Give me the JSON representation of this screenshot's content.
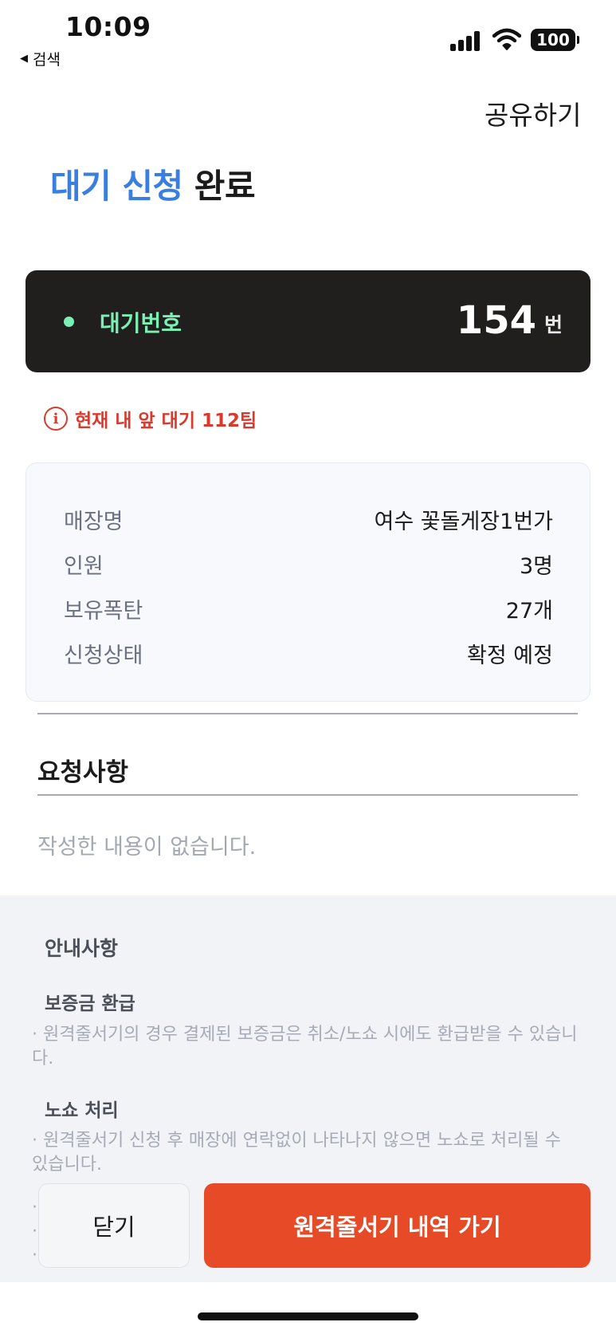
{
  "status_bar": {
    "time": "10:09",
    "back_label": "검색",
    "battery": "100"
  },
  "header": {
    "share_label": "공유하기"
  },
  "title": {
    "highlight": "대기 신청",
    "rest": " 완료",
    "highlight_color": "#3a7ee2"
  },
  "wait_card": {
    "label": "대기번호",
    "number": "154",
    "unit": "번",
    "accent_color": "#7af0b4"
  },
  "ahead_notice": {
    "icon": "info-icon",
    "text": "현재 내 앞 대기 112팀"
  },
  "details": [
    {
      "key": "매장명",
      "value": "여수 꽃돌게장1번가"
    },
    {
      "key": "인원",
      "value": "3명"
    },
    {
      "key": "보유폭탄",
      "value": "27개"
    },
    {
      "key": "신청상태",
      "value": "확정 예정"
    }
  ],
  "request": {
    "title": "요청사항",
    "empty_text": "작성한 내용이 없습니다."
  },
  "notice": {
    "title": "안내사항",
    "sections": [
      {
        "heading": "보증금 환급",
        "body": "· 원격줄서기의 경우 결제된 보증금은 취소/노쇼 시에도 환급받을 수 있습니다."
      },
      {
        "heading": "노쇼 처리",
        "body": "· 원격줄서기 신청 후 매장에 연락없이 나타나지 않으면 노쇼로 처리될 수 있습니다."
      }
    ],
    "truncated_bullets": [
      "·",
      "·",
      "·"
    ]
  },
  "buttons": {
    "close_label": "닫기",
    "go_label": "원격줄서기 내역 가기",
    "primary_color": "#e64a27"
  }
}
